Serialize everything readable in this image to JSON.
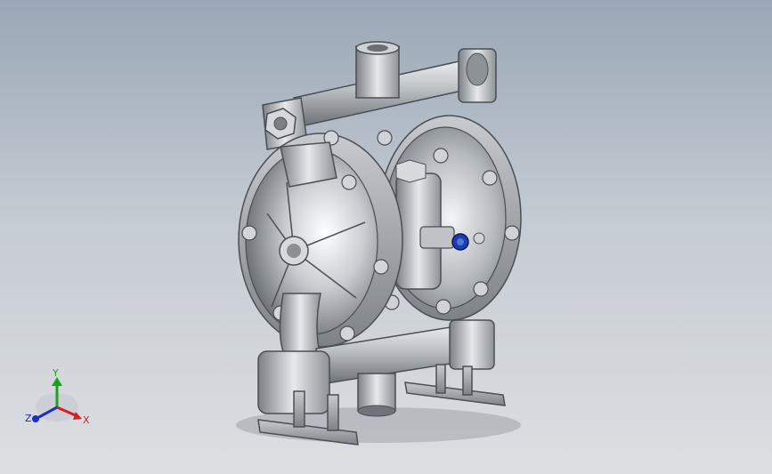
{
  "viewport": {
    "background_top": "#9aa7b6",
    "background_bottom": "#dcdfe2"
  },
  "model": {
    "icon": "diaphragm-pump-model",
    "metal_light": "#e9ecef",
    "metal_mid": "#a9aeb3",
    "metal_dark": "#5b6066",
    "fitting_accent": "#1c3fb0"
  },
  "triad": {
    "x_label": "X",
    "y_label": "Y",
    "z_label": "Z",
    "x_color": "#d42020",
    "y_color": "#1aa31a",
    "z_color": "#1c2fd0"
  }
}
